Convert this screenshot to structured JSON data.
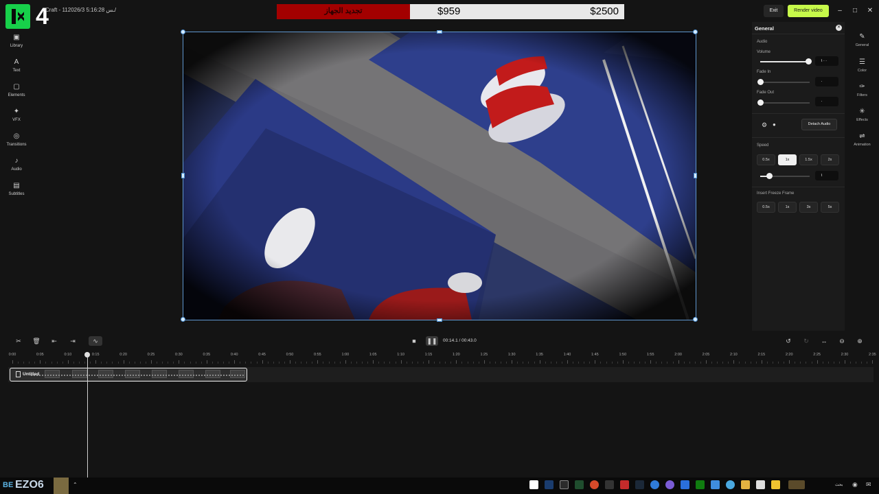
{
  "topbar": {
    "logo_digit": "4",
    "doc_title": "Craft - 11ـس 5:16:28 2026/3/",
    "donation": {
      "label": "تجديد الجهاز",
      "current": "$959",
      "goal": "$2500",
      "progress": 0.384
    },
    "exit_label": "Exit",
    "render_label": "Render video",
    "window_controls": [
      "minimize-icon",
      "maximize-icon",
      "close-icon"
    ]
  },
  "left_nav": [
    {
      "label": "Library",
      "icon": "library-icon"
    },
    {
      "label": "Text",
      "icon": "text-icon"
    },
    {
      "label": "Elements",
      "icon": "elements-icon"
    },
    {
      "label": "VFX",
      "icon": "vfx-icon"
    },
    {
      "label": "Transitions",
      "icon": "transitions-icon"
    },
    {
      "label": "Audio",
      "icon": "audio-icon"
    },
    {
      "label": "Subtitles",
      "icon": "subtitles-icon"
    }
  ],
  "panel": {
    "title": "General",
    "audio_section": "Audio",
    "volume": {
      "label": "Volume",
      "value": "١٠٠",
      "level": 1.0
    },
    "fade_in": {
      "label": "Fade In",
      "value": "٠",
      "level": 0
    },
    "fade_out": {
      "label": "Fade Out",
      "value": "٠",
      "level": 0
    },
    "detach_audio": "Detach Audio",
    "speed": {
      "label": "Speed",
      "options": [
        "0.5x",
        "1x",
        "1.5x",
        "2x"
      ],
      "selected": "1x",
      "value": "١"
    },
    "freeze": {
      "label": "Insert Freeze Frame",
      "options": [
        "0.5s",
        "1s",
        "3s",
        "5s"
      ]
    }
  },
  "right_tabs": [
    {
      "label": "General",
      "icon": "pencil-icon"
    },
    {
      "label": "Color",
      "icon": "sliders-icon"
    },
    {
      "label": "Filters",
      "icon": "filters-icon"
    },
    {
      "label": "Effects",
      "icon": "effects-icon"
    },
    {
      "label": "Animation",
      "icon": "animation-icon"
    }
  ],
  "timeline": {
    "time_current": "00:14.1",
    "time_total": "00:43.0",
    "ruler_labels": [
      "0:00",
      "0:05",
      "0:10",
      "0:15",
      "0:20",
      "0:25",
      "0:30",
      "0:35",
      "0:40",
      "0:45",
      "0:50",
      "0:55",
      "1:00",
      "1:05",
      "1:10",
      "1:15",
      "1:20",
      "1:25",
      "1:30",
      "1:35",
      "1:40",
      "1:45",
      "1:50",
      "1:55",
      "2:00",
      "2:05",
      "2:10",
      "2:15",
      "2:20",
      "2:25",
      "2:30",
      "2:35"
    ],
    "clip_name": "Untitled"
  },
  "taskbar": {
    "overlay_prefix": "BE",
    "overlay_text": "EZO6",
    "language": "بحث"
  }
}
